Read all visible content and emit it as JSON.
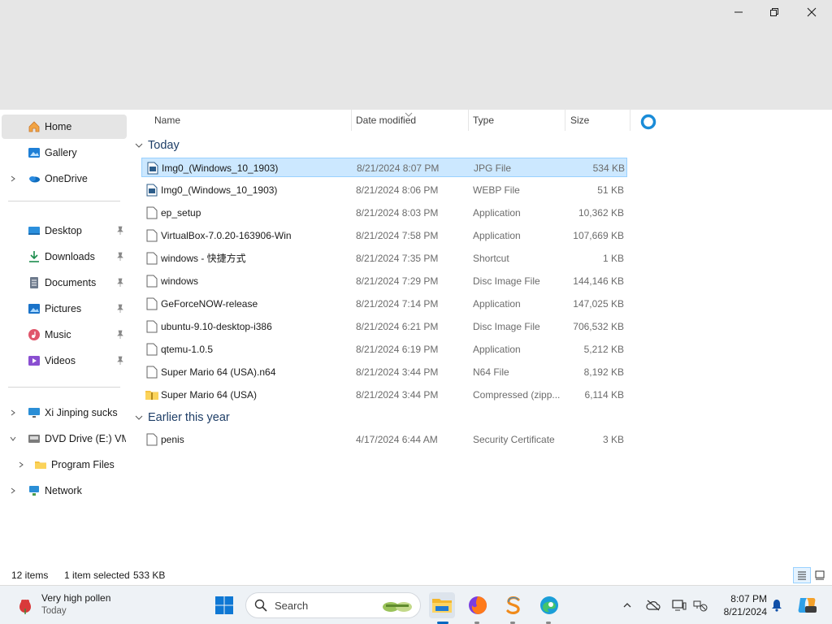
{
  "window": {
    "minimize": "minimize",
    "maximize": "restore",
    "close": "close"
  },
  "sidebar": {
    "items": [
      {
        "label": "Home",
        "icon": "home-icon"
      },
      {
        "label": "Gallery",
        "icon": "gallery-icon"
      },
      {
        "label": "OneDrive",
        "icon": "onedrive-icon"
      },
      {
        "label": "Desktop",
        "icon": "desktop-folder-icon"
      },
      {
        "label": "Downloads",
        "icon": "downloads-icon"
      },
      {
        "label": "Documents",
        "icon": "documents-icon"
      },
      {
        "label": "Pictures",
        "icon": "pictures-icon"
      },
      {
        "label": "Music",
        "icon": "music-icon"
      },
      {
        "label": "Videos",
        "icon": "videos-icon"
      },
      {
        "label": "Xi Jinping sucks",
        "icon": "pc-icon"
      },
      {
        "label": "DVD Drive (E:) VMw",
        "icon": "dvd-drive-icon"
      },
      {
        "label": "Program Files",
        "icon": "folder-icon"
      },
      {
        "label": "Network",
        "icon": "network-icon"
      }
    ]
  },
  "columns": {
    "name": "Name",
    "date": "Date modified",
    "type": "Type",
    "size": "Size"
  },
  "groups": {
    "today": "Today",
    "earlier": "Earlier this year"
  },
  "files": [
    {
      "name": "Img0_(Windows_10_1903)",
      "date": "8/21/2024 8:07 PM",
      "type": "JPG File",
      "size": "534 KB"
    },
    {
      "name": "Img0_(Windows_10_1903)",
      "date": "8/21/2024 8:06 PM",
      "type": "WEBP File",
      "size": "51 KB"
    },
    {
      "name": "ep_setup",
      "date": "8/21/2024 8:03 PM",
      "type": "Application",
      "size": "10,362 KB"
    },
    {
      "name": "VirtualBox-7.0.20-163906-Win",
      "date": "8/21/2024 7:58 PM",
      "type": "Application",
      "size": "107,669 KB"
    },
    {
      "name": "windows - 快捷方式",
      "date": "8/21/2024 7:35 PM",
      "type": "Shortcut",
      "size": "1 KB"
    },
    {
      "name": "windows",
      "date": "8/21/2024 7:29 PM",
      "type": "Disc Image File",
      "size": "144,146 KB"
    },
    {
      "name": "GeForceNOW-release",
      "date": "8/21/2024 7:14 PM",
      "type": "Application",
      "size": "147,025 KB"
    },
    {
      "name": "ubuntu-9.10-desktop-i386",
      "date": "8/21/2024 6:21 PM",
      "type": "Disc Image File",
      "size": "706,532 KB"
    },
    {
      "name": "qtemu-1.0.5",
      "date": "8/21/2024 6:19 PM",
      "type": "Application",
      "size": "5,212 KB"
    },
    {
      "name": "Super Mario 64 (USA).n64",
      "date": "8/21/2024 3:44 PM",
      "type": "N64 File",
      "size": "8,192 KB"
    },
    {
      "name": "Super Mario 64 (USA)",
      "date": "8/21/2024 3:44 PM",
      "type": "Compressed (zipp...",
      "size": "6,114 KB"
    },
    {
      "name": "penis",
      "date": "4/17/2024 6:44 AM",
      "type": "Security Certificate",
      "size": "3 KB"
    }
  ],
  "status": {
    "count": "12 items",
    "selection": "1 item selected",
    "selection_size": "533 KB"
  },
  "taskbar": {
    "weather_title": "Very high pollen",
    "weather_sub": "Today",
    "search_placeholder": "Search",
    "time": "8:07 PM",
    "date": "8/21/2024"
  },
  "colors": {
    "accent": "#0067c0",
    "selection_bg": "#cce8ff",
    "selection_border": "#99d1ff",
    "group_header": "#1f3f68"
  }
}
